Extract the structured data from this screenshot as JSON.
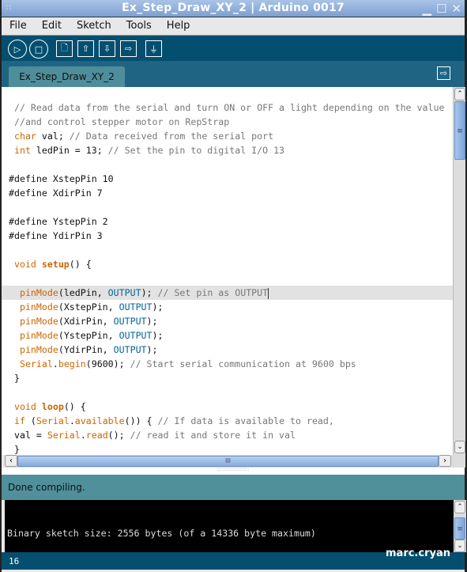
{
  "window": {
    "title": "Ex_Step_Draw_XY_2 | Arduino 0017"
  },
  "menu": [
    "File",
    "Edit",
    "Sketch",
    "Tools",
    "Help"
  ],
  "toolbar": [
    {
      "name": "verify-button",
      "icon": "play-icon",
      "glyph": "▷"
    },
    {
      "name": "stop-button",
      "icon": "stop-icon",
      "glyph": "□"
    },
    {
      "name": "new-button",
      "icon": "new-file-icon",
      "glyph": "🗋"
    },
    {
      "name": "open-button",
      "icon": "upload-arrow-icon",
      "glyph": "⇧"
    },
    {
      "name": "save-button",
      "icon": "download-arrow-icon",
      "glyph": "⇩"
    },
    {
      "name": "upload-button",
      "icon": "arrow-right-icon",
      "glyph": "⇨"
    },
    {
      "name": "serial-monitor-button",
      "icon": "serial-monitor-icon",
      "glyph": "⏚"
    }
  ],
  "tab": {
    "label": "Ex_Step_Draw_XY_2",
    "menu_glyph": "⇨"
  },
  "code": [
    [
      [
        "c",
        " // Read data from the serial and turn ON or OFF a light depending on the value"
      ]
    ],
    [
      [
        "c",
        " //and control stepper motor on RepStrap"
      ]
    ],
    [
      [
        "t",
        " "
      ],
      [
        "k",
        "char"
      ],
      [
        "t",
        " val; "
      ],
      [
        "c",
        "// Data received from the serial port"
      ]
    ],
    [
      [
        "t",
        " "
      ],
      [
        "k",
        "int"
      ],
      [
        "t",
        " ledPin = 13; "
      ],
      [
        "c",
        "// Set the pin to digital I/O 13"
      ]
    ],
    [],
    [
      [
        "t",
        "#define XstepPin 10"
      ]
    ],
    [
      [
        "t",
        "#define XdirPin 7"
      ]
    ],
    [],
    [
      [
        "t",
        "#define YstepPin 2"
      ]
    ],
    [
      [
        "t",
        "#define YdirPin 3"
      ]
    ],
    [],
    [
      [
        "t",
        " "
      ],
      [
        "k",
        "void"
      ],
      [
        "t",
        " "
      ],
      [
        "kb",
        "setup"
      ],
      [
        "t",
        "() {"
      ]
    ],
    [],
    [
      [
        "t",
        "  "
      ],
      [
        "k",
        "pinMode"
      ],
      [
        "t",
        "(ledPin, "
      ],
      [
        "b",
        "OUTPUT"
      ],
      [
        "t",
        "); "
      ],
      [
        "c",
        "// Set pin as OUTPUT"
      ]
    ],
    [
      [
        "t",
        "  "
      ],
      [
        "k",
        "pinMode"
      ],
      [
        "t",
        "(XstepPin, "
      ],
      [
        "b",
        "OUTPUT"
      ],
      [
        "t",
        ");"
      ]
    ],
    [
      [
        "t",
        "  "
      ],
      [
        "k",
        "pinMode"
      ],
      [
        "t",
        "(XdirPin, "
      ],
      [
        "b",
        "OUTPUT"
      ],
      [
        "t",
        ");"
      ]
    ],
    [
      [
        "t",
        "  "
      ],
      [
        "k",
        "pinMode"
      ],
      [
        "t",
        "(YstepPin, "
      ],
      [
        "b",
        "OUTPUT"
      ],
      [
        "t",
        ");"
      ]
    ],
    [
      [
        "t",
        "  "
      ],
      [
        "k",
        "pinMode"
      ],
      [
        "t",
        "(YdirPin, "
      ],
      [
        "b",
        "OUTPUT"
      ],
      [
        "t",
        ");"
      ]
    ],
    [
      [
        "t",
        "  "
      ],
      [
        "k",
        "Serial"
      ],
      [
        "t",
        "."
      ],
      [
        "k",
        "begin"
      ],
      [
        "t",
        "(9600); "
      ],
      [
        "c",
        "// Start serial communication at 9600 bps"
      ]
    ],
    [
      [
        "t",
        " }"
      ]
    ],
    [],
    [
      [
        "t",
        " "
      ],
      [
        "k",
        "void"
      ],
      [
        "t",
        " "
      ],
      [
        "kb",
        "loop"
      ],
      [
        "t",
        "() {"
      ]
    ],
    [
      [
        "t",
        " "
      ],
      [
        "k",
        "if"
      ],
      [
        "t",
        " ("
      ],
      [
        "k",
        "Serial"
      ],
      [
        "t",
        "."
      ],
      [
        "k",
        "available"
      ],
      [
        "t",
        "()) { "
      ],
      [
        "c",
        "// If data is available to read,"
      ]
    ],
    [
      [
        "t",
        " val = "
      ],
      [
        "k",
        "Serial"
      ],
      [
        "t",
        "."
      ],
      [
        "k",
        "read"
      ],
      [
        "t",
        "(); "
      ],
      [
        "c",
        "// read it and store it in val"
      ]
    ],
    [
      [
        "t",
        " }"
      ]
    ]
  ],
  "highlighted_line": 13,
  "status": {
    "message": "Done compiling."
  },
  "console": {
    "text": "Binary sketch size: 2556 bytes (of a 14336 byte maximum)"
  },
  "line_number": "16",
  "watermark": "marc.cryan",
  "colors": {
    "toolbar": "#044f6f",
    "tabbar": "#1f6583",
    "status": "#4f909b",
    "keyword": "#cc6600",
    "constant": "#006699",
    "comment": "#777777"
  }
}
